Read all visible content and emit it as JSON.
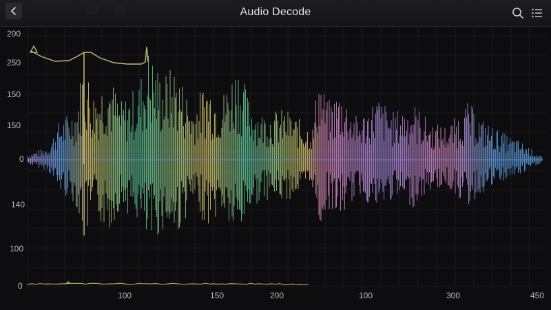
{
  "window": {
    "title": "Audio Decode"
  },
  "toolbar": {
    "back_icon": "chevron-left-icon",
    "search_icon": "search-icon",
    "list_icon": "list-icon"
  },
  "chart_data": {
    "type": "line",
    "title": "",
    "xlabel": "",
    "ylabel": "",
    "y_tick_labels": [
      "200",
      "250",
      "150",
      "150",
      "0",
      "140",
      "100",
      "0"
    ],
    "x_tick_labels": [
      "100",
      "150",
      "200",
      "100",
      "300",
      "450"
    ],
    "marker_label": "A",
    "colors": {
      "yellow": "#d8c66a",
      "green": "#59c89a",
      "blue": "#5b9fe0",
      "purple": "#a78be0",
      "pink": "#d889c0",
      "envelope": "#c9b777"
    },
    "grid": true,
    "legend": "none"
  }
}
